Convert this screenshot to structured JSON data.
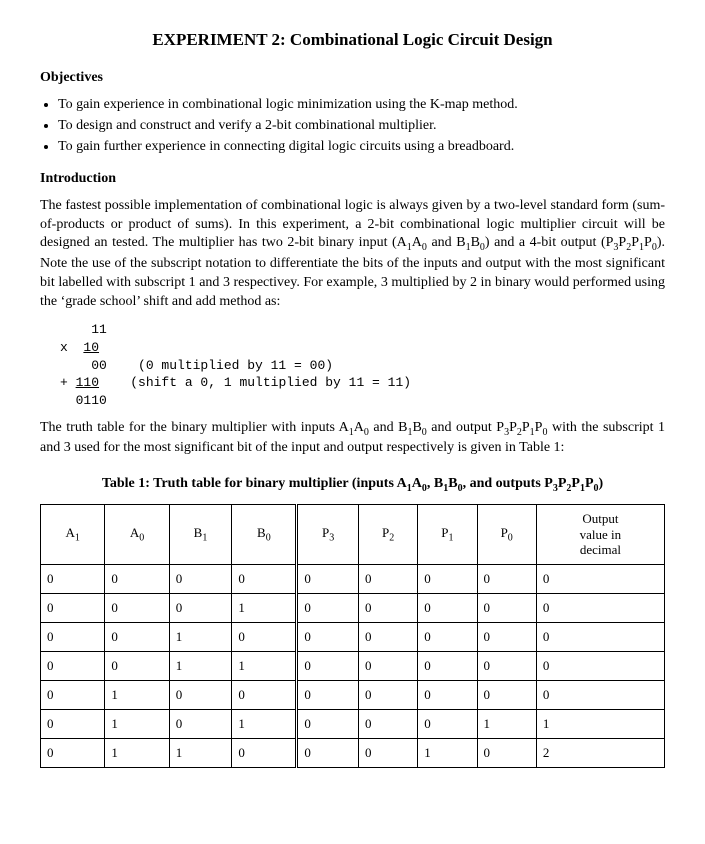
{
  "title": "EXPERIMENT 2: Combinational Logic Circuit Design",
  "sections": {
    "objectives_h": "Objectives",
    "objectives": [
      "To gain experience in combinational logic minimization using the K-map method.",
      "To design and construct and verify a 2-bit combinational multiplier.",
      "To gain further experience in connecting digital logic circuits using a breadboard."
    ],
    "intro_h": "Introduction",
    "intro_p1_a": "The fastest possible implementation of combinational logic is always given by a two-level standard form (sum-of-products or product of sums). In this experiment, a 2-bit combinational logic multiplier circuit will be designed an tested. The multiplier has two 2-bit binary input (A",
    "intro_p1_b": "A",
    "intro_p1_c": " and B",
    "intro_p1_d": "B",
    "intro_p1_e": ") and a 4-bit output (P",
    "intro_p1_f": "P",
    "intro_p1_g": "P",
    "intro_p1_h": "P",
    "intro_p1_i": ").  Note the use of the subscript notation to differentiate the bits of the inputs and output with the most significant bit labelled with subscript 1 and 3 respectivey. For example, 3 multiplied by 2 in binary would performed using the ‘grade school’ shift and add method as:",
    "calc": {
      "l1": "    11",
      "l2a": "x  ",
      "l2b": "10",
      "l3": "    00    (0 multiplied by 11 = 00)",
      "l4a": "+ ",
      "l4b": "110",
      "l4c": "    (shift a 0, 1 multiplied by 11 = 11)",
      "l5": "  0110"
    },
    "intro_p2_a": "The truth table for the binary multiplier with inputs A",
    "intro_p2_b": "A",
    "intro_p2_c": " and B",
    "intro_p2_d": "B",
    "intro_p2_e": " and output P",
    "intro_p2_f": "P",
    "intro_p2_g": "P",
    "intro_p2_h": "P",
    "intro_p2_i": " with the subscript 1 and 3 used for the most significant bit of the input and output respectively is given in Table 1:",
    "table_caption_a": "Table 1: Truth table for binary multiplier (inputs A",
    "table_caption_b": "A",
    "table_caption_c": ", B",
    "table_caption_d": "B",
    "table_caption_e": ", and outputs P",
    "table_caption_f": "P",
    "table_caption_g": "P",
    "table_caption_h": "P",
    "table_caption_i": ")"
  },
  "subscripts": {
    "one": "1",
    "zero": "0",
    "three": "3",
    "two": "2"
  },
  "table": {
    "headers": {
      "A1": "A",
      "A0": "A",
      "B1": "B",
      "B0": "B",
      "P3": "P",
      "P2": "P",
      "P1": "P",
      "P0": "P",
      "out_l1": "Output",
      "out_l2": "value in",
      "out_l3": "decimal"
    },
    "rows": [
      [
        "0",
        "0",
        "0",
        "0",
        "0",
        "0",
        "0",
        "0",
        "0"
      ],
      [
        "0",
        "0",
        "0",
        "1",
        "0",
        "0",
        "0",
        "0",
        "0"
      ],
      [
        "0",
        "0",
        "1",
        "0",
        "0",
        "0",
        "0",
        "0",
        "0"
      ],
      [
        "0",
        "0",
        "1",
        "1",
        "0",
        "0",
        "0",
        "0",
        "0"
      ],
      [
        "0",
        "1",
        "0",
        "0",
        "0",
        "0",
        "0",
        "0",
        "0"
      ],
      [
        "0",
        "1",
        "0",
        "1",
        "0",
        "0",
        "0",
        "1",
        "1"
      ],
      [
        "0",
        "1",
        "1",
        "0",
        "0",
        "0",
        "1",
        "0",
        "2"
      ]
    ]
  }
}
